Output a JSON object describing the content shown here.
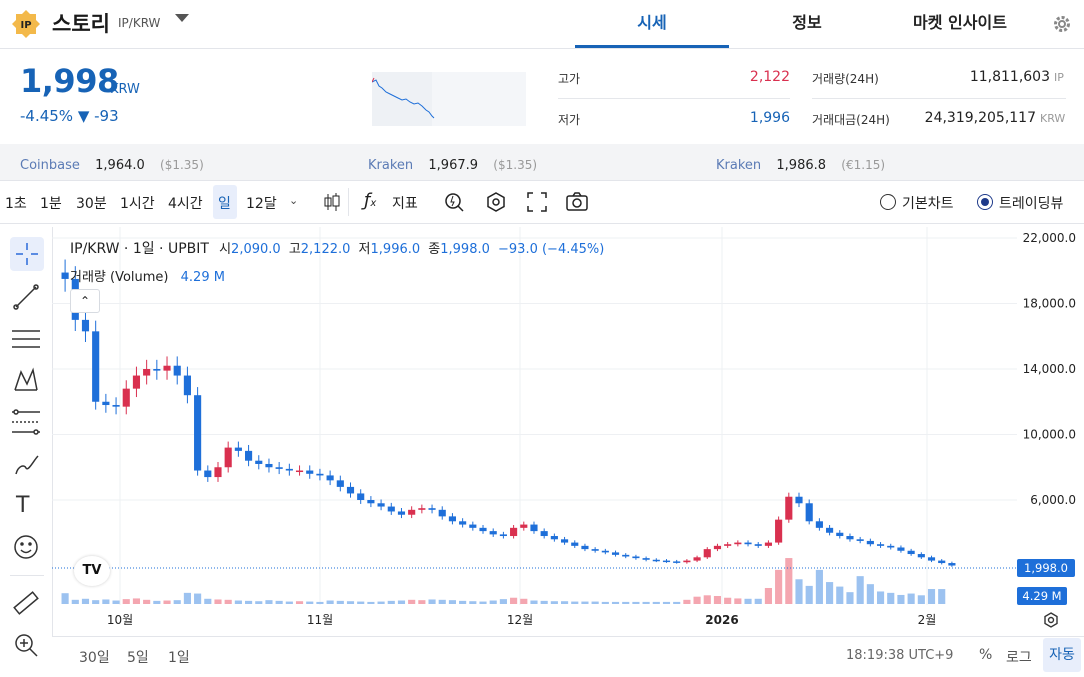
{
  "header": {
    "coin_name": "스토리",
    "coin_pair": "IP/KRW",
    "logo_text": "IP",
    "tabs": [
      {
        "label": "시세",
        "active": true
      },
      {
        "label": "정보",
        "active": false
      },
      {
        "label": "마켓 인사이트",
        "active": false
      }
    ]
  },
  "price": {
    "value": "1,998",
    "unit": "KRW",
    "change": "-4.45% ▼ -93"
  },
  "stats": {
    "high_label": "고가",
    "high_value": "2,122",
    "low_label": "저가",
    "low_value": "1,996",
    "volume_label": "거래량(24H)",
    "volume_value": "11,811,603",
    "volume_unit": "IP",
    "amount_label": "거래대금(24H)",
    "amount_value": "24,319,205,117",
    "amount_unit": "KRW"
  },
  "exchanges": [
    {
      "name": "Coinbase",
      "price": "1,964.0",
      "quote": "($1.35)"
    },
    {
      "name": "Kraken",
      "price": "1,967.9",
      "quote": "($1.35)"
    },
    {
      "name": "Kraken",
      "price": "1,986.8",
      "quote": "(€1.15)"
    }
  ],
  "toolbar": {
    "timeframes": [
      "1초",
      "1분",
      "30분",
      "1시간",
      "4시간",
      "일",
      "12달"
    ],
    "active_timeframe": "일",
    "indicator_label": "지표",
    "view_basic": "기본차트",
    "view_trading": "트레이딩뷰"
  },
  "chart": {
    "legend_symbol": "IP/KRW · 1일 · UPBIT",
    "o_label": "시",
    "o_value": "2,090.0",
    "h_label": "고",
    "h_value": "2,122.0",
    "l_label": "저",
    "l_value": "1,996.0",
    "c_label": "종",
    "c_value": "1,998.0",
    "change_value": "−93.0 (−4.45%)",
    "volume_label": "거래량 (Volume)",
    "volume_value": "4.29 M",
    "price_tag": "1,998.0",
    "volume_tag": "4.29 M",
    "y_ticks": [
      "22,000.0",
      "18,000.0",
      "14,000.0",
      "10,000.0",
      "6,000.0"
    ],
    "x_ticks": [
      "10월",
      "11월",
      "12월",
      "2026",
      "2월"
    ],
    "colors": {
      "up": "#d9304f",
      "down": "#1e6fd9",
      "vol_up": "#f4a6b0",
      "vol_down": "#9cc2f0"
    }
  },
  "bottom": {
    "ranges": [
      "30일",
      "5일",
      "1일"
    ],
    "time": "18:19:38 UTC+9",
    "percent": "%",
    "log": "로그",
    "auto": "자동"
  },
  "chart_data": {
    "type": "candlestick",
    "title": "",
    "ylim": [
      0,
      22500
    ],
    "x": [
      "10월",
      "11월",
      "12월",
      "2026",
      "2월"
    ],
    "series": [
      {
        "name": "IP/KRW",
        "close": [
          19500,
          17000,
          16300,
          12000,
          11800,
          11700,
          12800,
          13600,
          14000,
          13900,
          14200,
          13600,
          12400,
          7800,
          7400,
          8000,
          9200,
          9000,
          8400,
          8200,
          8000,
          7900,
          7800,
          7800,
          7600,
          7500,
          7200,
          6800,
          6400,
          6000,
          5800,
          5600,
          5300,
          5100,
          5400,
          5500,
          5400,
          5000,
          4700,
          4500,
          4300,
          4100,
          3900,
          3800,
          4300,
          4500,
          4100,
          3800,
          3600,
          3400,
          3200,
          3000,
          2900,
          2800,
          2650,
          2550,
          2450,
          2350,
          2300,
          2250,
          2200,
          2300,
          2500,
          3000,
          3200,
          3300,
          3400,
          3300,
          3200,
          3400,
          4800,
          6200,
          5800,
          4700,
          4300,
          4000,
          3800,
          3600,
          3500,
          3300,
          3200,
          3100,
          2900,
          2700,
          2500,
          2300,
          2150,
          1998
        ]
      },
      {
        "name": "거래량 (Volume)",
        "values": [
          3.1,
          1.2,
          1.5,
          1.1,
          1.3,
          1.0,
          1.4,
          1.6,
          1.2,
          0.9,
          1.0,
          1.1,
          3.2,
          3.0,
          1.5,
          1.3,
          1.2,
          1.0,
          0.9,
          0.8,
          1.1,
          0.9,
          0.7,
          0.8,
          0.7,
          0.6,
          1.0,
          0.9,
          0.8,
          0.7,
          0.6,
          0.7,
          0.9,
          1.0,
          1.2,
          1.1,
          1.3,
          1.2,
          1.1,
          0.9,
          0.8,
          0.7,
          1.0,
          1.4,
          1.8,
          1.5,
          1.0,
          0.9,
          0.8,
          0.8,
          0.7,
          0.7,
          0.7,
          0.6,
          0.6,
          0.6,
          0.6,
          0.6,
          0.6,
          0.6,
          0.6,
          1.2,
          2.1,
          2.5,
          2.3,
          1.8,
          1.6,
          1.5,
          1.5,
          4.6,
          9.8,
          13.2,
          7.1,
          5.2,
          9.8,
          6.3,
          5.0,
          3.4,
          8.0,
          5.7,
          3.6,
          3.2,
          2.6,
          3.0,
          2.5,
          4.3,
          4.29
        ]
      }
    ]
  }
}
